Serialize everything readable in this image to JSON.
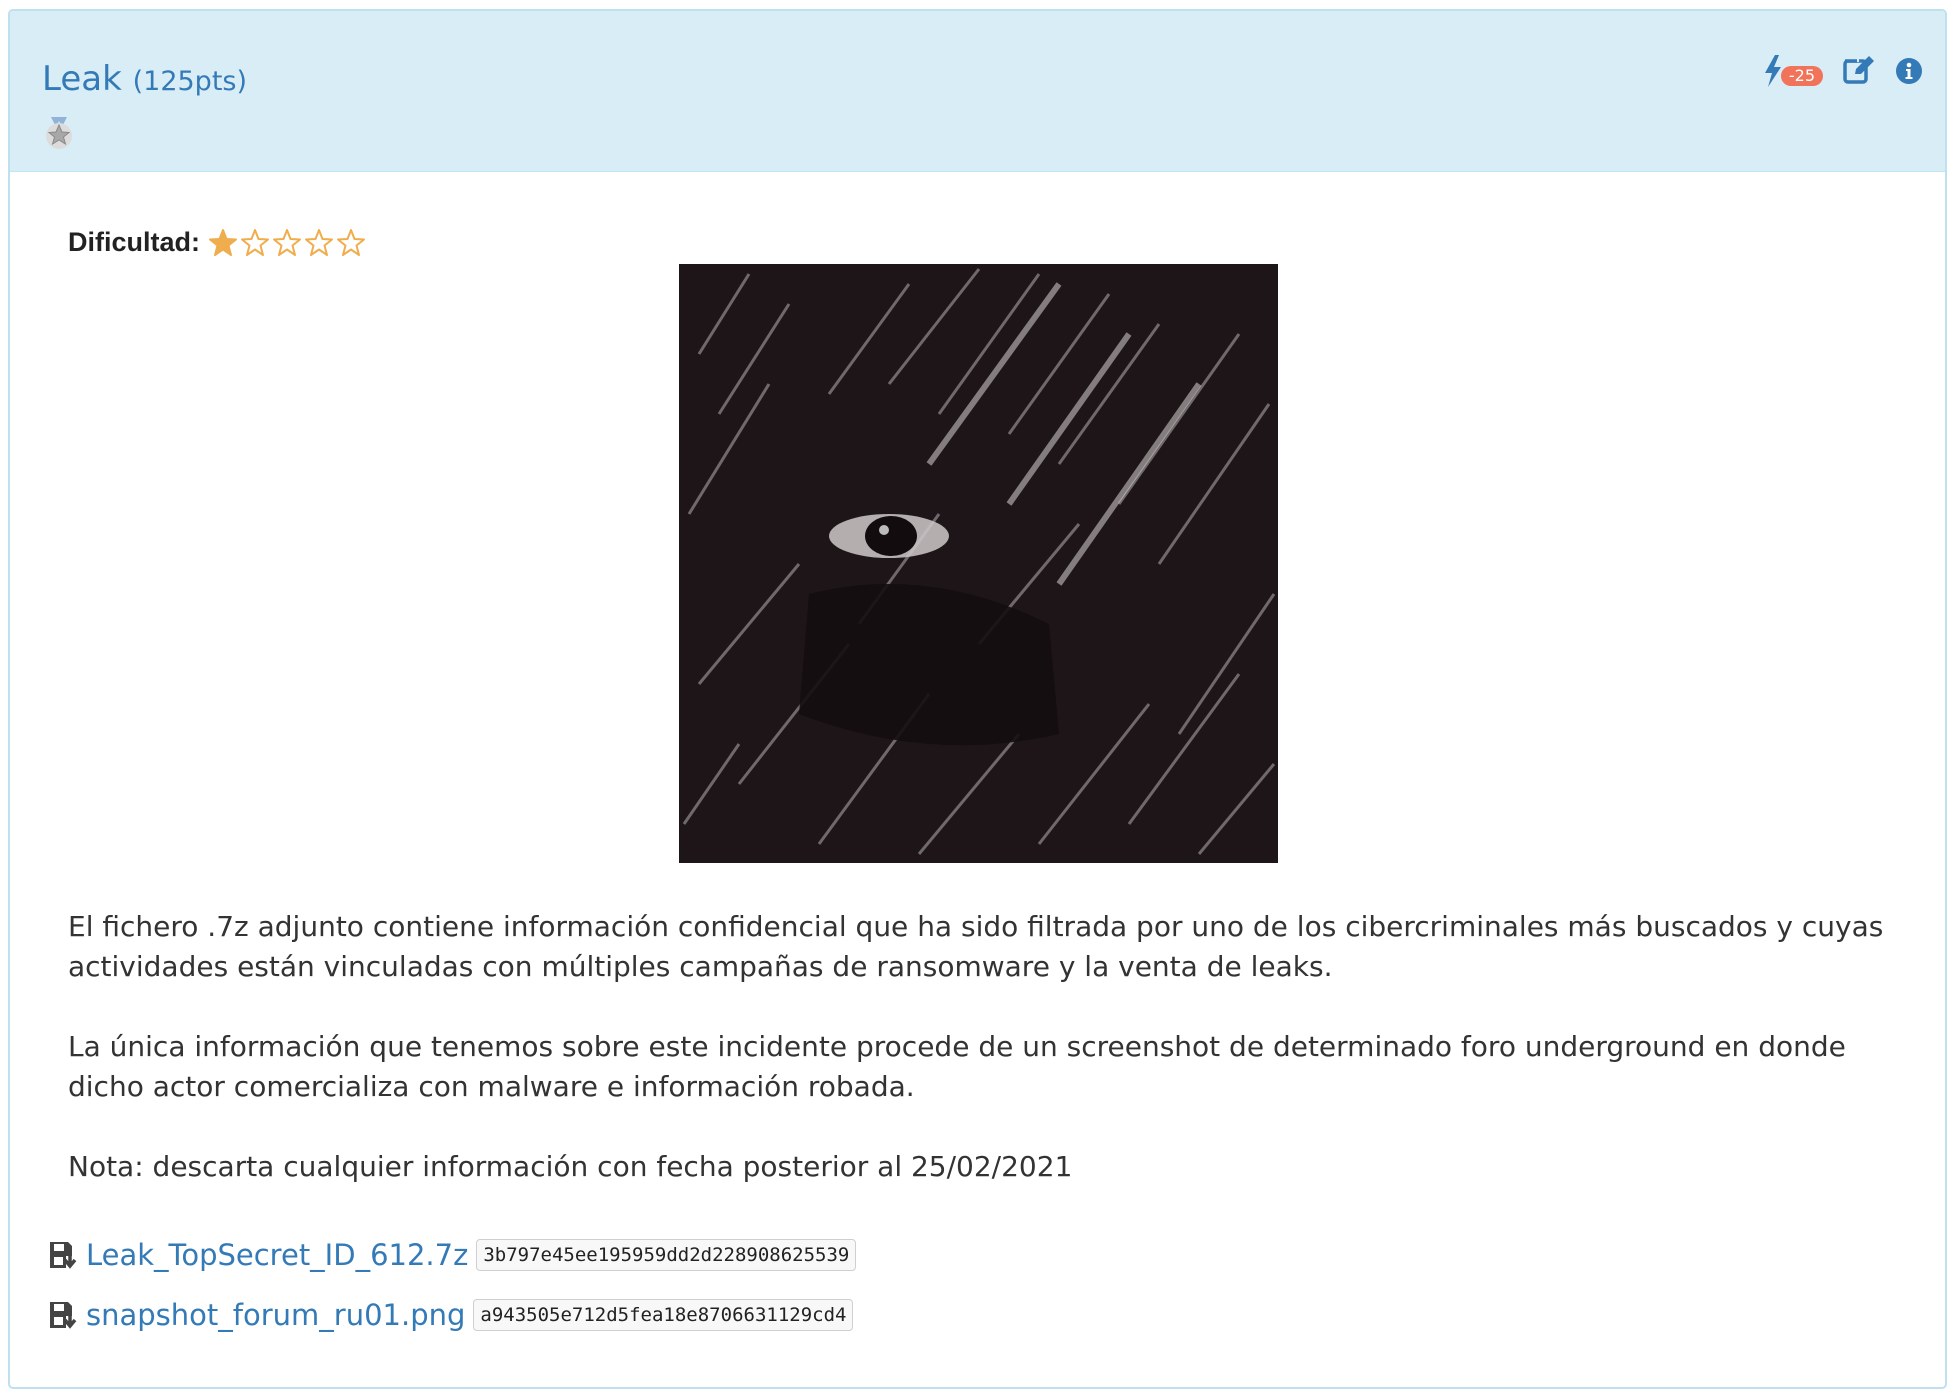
{
  "challenge": {
    "title": "Leak",
    "points": "(125pts)",
    "penalty_badge": "-25",
    "difficulty_label": "Dificultad:",
    "difficulty_rating": 1,
    "difficulty_max": 5,
    "description": [
      "El fichero .7z adjunto contiene información confidencial que ha sido filtrada por uno de los cibercriminales más buscados y cuyas actividades están vinculadas con múltiples campañas de ransomware y la venta de leaks.",
      "La única información que tenemos sobre este incidente procede de un screenshot de determinado foro underground en donde dicho actor comercializa con malware e información robada.",
      "Nota: descarta cualquier información con fecha posterior al 25/02/2021"
    ]
  },
  "icons": {
    "badge": "star-badge-icon",
    "hint": "bolt-icon",
    "edit": "edit-icon",
    "info": "info-icon",
    "file": "file-download-icon",
    "star_full": "star-filled-icon",
    "star_empty": "star-empty-icon"
  },
  "colors": {
    "heading_bg": "#d9edf7",
    "link": "#337ab7",
    "star": "#f0ad4e",
    "penalty": "#f0735a"
  },
  "files": [
    {
      "name": "Leak_TopSecret_ID_612.7z",
      "hash": "3b797e45ee195959dd2d228908625539"
    },
    {
      "name": "snapshot_forum_ru01.png",
      "hash": "a943505e712d5fea18e8706631129cd4"
    }
  ]
}
